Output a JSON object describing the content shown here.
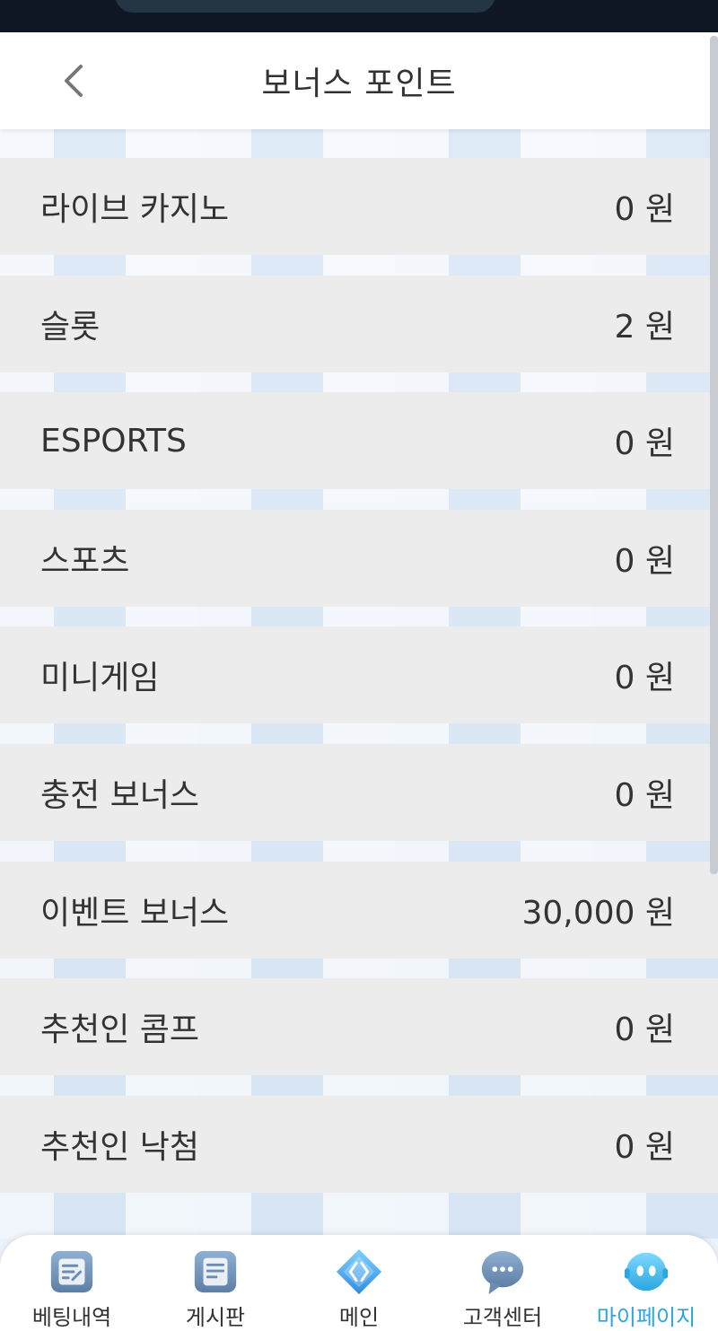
{
  "header": {
    "title": "보너스 포인트"
  },
  "rows": [
    {
      "label": "라이브 카지노",
      "value": "0 원"
    },
    {
      "label": "슬롯",
      "value": "2 원"
    },
    {
      "label": "ESPORTS",
      "value": "0 원"
    },
    {
      "label": "스포츠",
      "value": "0 원"
    },
    {
      "label": "미니게임",
      "value": "0 원"
    },
    {
      "label": "충전 보너스",
      "value": "0 원"
    },
    {
      "label": "이벤트 보너스",
      "value": "30,000 원"
    },
    {
      "label": "추천인 콤프",
      "value": "0 원"
    },
    {
      "label": "추천인 낙첨",
      "value": "0 원"
    }
  ],
  "tabbar": {
    "tabs": [
      {
        "label": "베팅내역",
        "icon": "betting-history-icon"
      },
      {
        "label": "게시판",
        "icon": "board-icon"
      },
      {
        "label": "메인",
        "icon": "main-diamond-icon"
      },
      {
        "label": "고객센터",
        "icon": "chat-bubble-icon"
      },
      {
        "label": "마이페이지",
        "icon": "mypage-robot-icon"
      }
    ],
    "active_index": 4,
    "active_color": "#2aa7e0"
  }
}
